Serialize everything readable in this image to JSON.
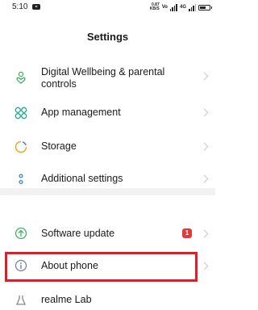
{
  "status_bar": {
    "time": "5:10",
    "network_speed_top": "0.87",
    "network_speed_bottom": "KB/S",
    "volte_badge": "VoLTE"
  },
  "header": {
    "title": "Settings"
  },
  "settings_items": [
    {
      "label": "Digital Wellbeing & parental controls",
      "icon": "heart-person-icon",
      "color": "#3fae6b"
    },
    {
      "label": "App management",
      "icon": "grid-icon",
      "color": "#1ea69a"
    },
    {
      "label": "Storage",
      "icon": "pie-chart-icon",
      "color": "#f0a020"
    },
    {
      "label": "Additional settings",
      "icon": "dots-icon",
      "color": "#3b7fd6"
    },
    {
      "label": "Software update",
      "icon": "upload-arrow-icon",
      "color": "#3fae6b",
      "badge": "1"
    },
    {
      "label": "About phone",
      "icon": "info-icon",
      "color": "#6c7fa0"
    },
    {
      "label": "realme Lab",
      "icon": "lab-icon",
      "color": "#888888"
    }
  ],
  "colors": {
    "badge": "#e23a3a",
    "highlight": "#dd1f2b",
    "chevron": "#c8c8c8",
    "section_gap": "#f2f2f2"
  }
}
